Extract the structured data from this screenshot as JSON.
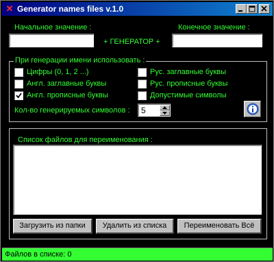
{
  "window": {
    "title": "Generator names files v.1.0"
  },
  "top": {
    "start_label": "Начальное значение :",
    "start_value": "",
    "generator_label": "+ ГЕНЕРАТОР +",
    "end_label": "Конечное значение :",
    "end_value": ""
  },
  "options": {
    "legend": "При генерации имени использовать :",
    "checkboxes": [
      {
        "label": "Цифры (0, 1, 2 ...)",
        "checked": false
      },
      {
        "label": "Англ. заглавные буквы",
        "checked": false
      },
      {
        "label": "Англ. прописные буквы",
        "checked": true
      },
      {
        "label": "Рус. заглавные буквы",
        "checked": false
      },
      {
        "label": "Рус. прописные буквы",
        "checked": false
      },
      {
        "label": "Допустимые символы",
        "checked": false
      }
    ],
    "count_label": "Кол-во  генерируемых символов :",
    "count_value": "5"
  },
  "files": {
    "legend": "Список файлов для переименования :",
    "items": []
  },
  "buttons": {
    "load": "Загрузить из папки",
    "remove": "Удалить из списка",
    "rename_all": "Переименовать Всё"
  },
  "status": {
    "text": "Файлов в списке: 0"
  },
  "colors": {
    "background": "#000000",
    "text": "#33ff33",
    "status_bar": "#33ff33",
    "title_bar": "#000080"
  },
  "icons": {
    "app": "generator-app-icon",
    "info": "info-icon"
  }
}
